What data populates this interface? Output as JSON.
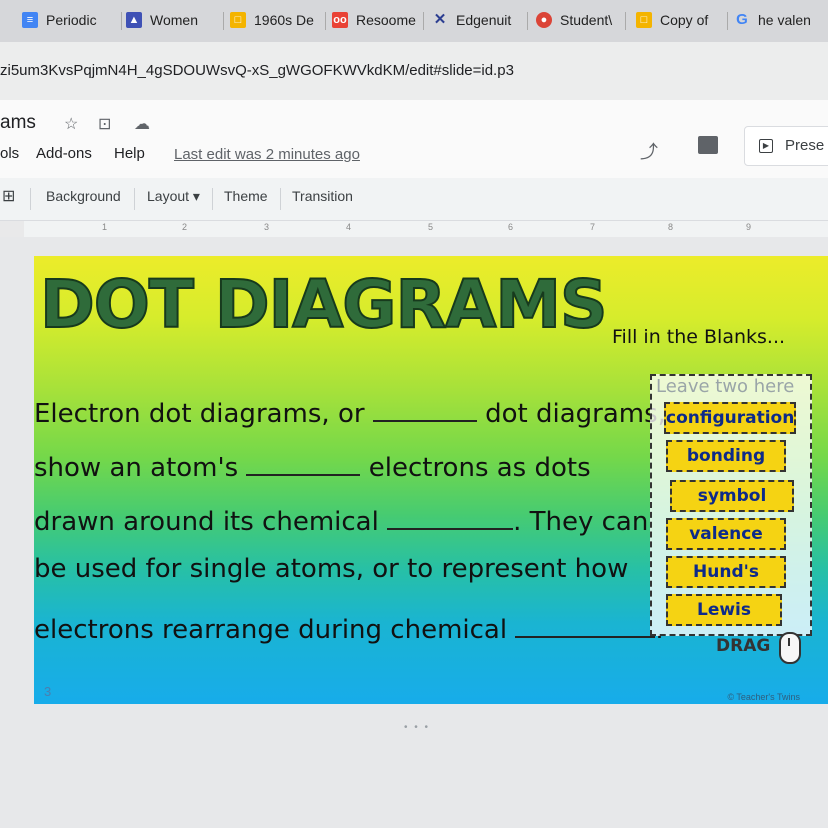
{
  "browser": {
    "tabs": [
      {
        "label": "Periodic",
        "icon": "slides-icon",
        "color": "#4285f4"
      },
      {
        "label": "Women",
        "icon": "classroom-icon",
        "color": "#3f51b5"
      },
      {
        "label": "1960s De",
        "icon": "slides-icon",
        "color": "#f4b400"
      },
      {
        "label": "Resoome",
        "icon": "oo-icon",
        "color": "#e94235"
      },
      {
        "label": "Edgenuit",
        "icon": "x-icon",
        "color": "#2c3e91"
      },
      {
        "label": "Student\\",
        "icon": "chrome-icon",
        "color": "#db4437"
      },
      {
        "label": "Copy of",
        "icon": "slides-icon",
        "color": "#f4b400"
      },
      {
        "label": "he valen",
        "icon": "google-icon",
        "color": "#4285f4"
      }
    ],
    "url": "zi5um3KvsPqjmN4H_4gSDOUWsvQ-xS_gWGOFKWVkdKM/edit#slide=id.p3"
  },
  "doc": {
    "title": "ams",
    "menu": [
      "ols",
      "Add-ons",
      "Help"
    ],
    "last_edit": "Last edit was 2 minutes ago",
    "present_label": "Prese"
  },
  "toolbar": {
    "background": "Background",
    "layout": "Layout",
    "theme": "Theme",
    "transition": "Transition"
  },
  "ruler": {
    "marks": [
      "1",
      "2",
      "3",
      "4",
      "5",
      "6",
      "7",
      "8",
      "9"
    ]
  },
  "slide": {
    "heading": "DOT DIAGRAMS",
    "subheading": "Fill in the Blanks...",
    "lines": [
      {
        "before": "Electron dot diagrams, or ",
        "after": " dot diagrams,"
      },
      {
        "before": "show an atom's ",
        "after": " electrons  as dots"
      },
      {
        "before": "drawn around its chemical ",
        "after": ".  They can"
      },
      {
        "before": "be used for single atoms, or to represent how",
        "after": ""
      },
      {
        "before": "electrons rearrange during chemical ",
        "after": "."
      }
    ],
    "word_bank_title": "Leave two here",
    "word_bank": [
      "configuration",
      "bonding",
      "symbol",
      "valence",
      "Hund's",
      "Lewis"
    ],
    "drag_label": "DRAG",
    "page_number": "3",
    "credit": "© Teacher's Twins"
  }
}
